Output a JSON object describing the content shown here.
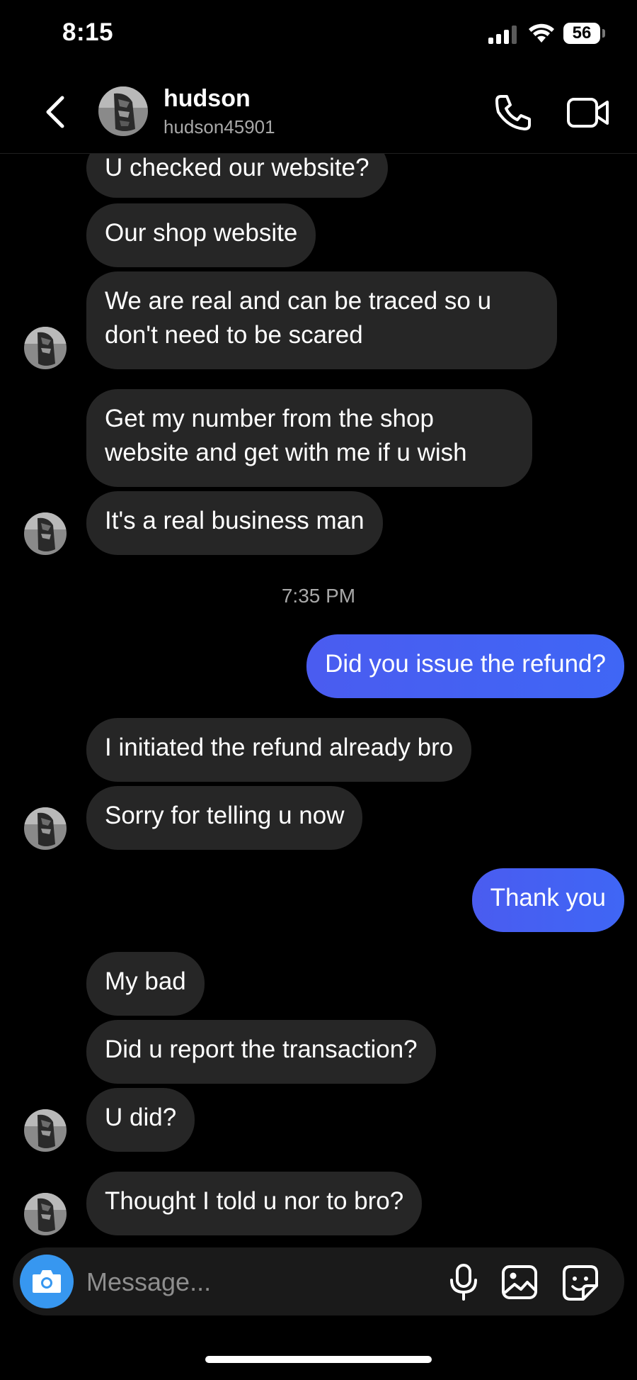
{
  "status_bar": {
    "time": "8:15",
    "battery": "56"
  },
  "header": {
    "name": "hudson",
    "username": "hudson45901"
  },
  "messages": [
    {
      "text": "U checked our website?",
      "sender": "them"
    },
    {
      "text": "Our shop website",
      "sender": "them"
    },
    {
      "text": "We are real and can be traced so u don't need to be scared",
      "sender": "them"
    },
    {
      "text": "Get my number from the shop website and get with me if u wish",
      "sender": "them"
    },
    {
      "text": "It's a real business man",
      "sender": "them"
    },
    {
      "text": "Did you issue the refund?",
      "sender": "me"
    },
    {
      "text": "I initiated the refund already bro",
      "sender": "them"
    },
    {
      "text": "Sorry for telling u now",
      "sender": "them"
    },
    {
      "text": "Thank you",
      "sender": "me"
    },
    {
      "text": "My bad",
      "sender": "them"
    },
    {
      "text": "Did u report the transaction?",
      "sender": "them"
    },
    {
      "text": "U did?",
      "sender": "them"
    },
    {
      "text": "Thought I told u nor to bro?",
      "sender": "them"
    }
  ],
  "timestamp": "7:35 PM",
  "composer": {
    "placeholder": "Message..."
  },
  "colors": {
    "sent_bubble": "#3f66f5",
    "received_bubble": "#262626",
    "camera_button": "#3797f0"
  }
}
